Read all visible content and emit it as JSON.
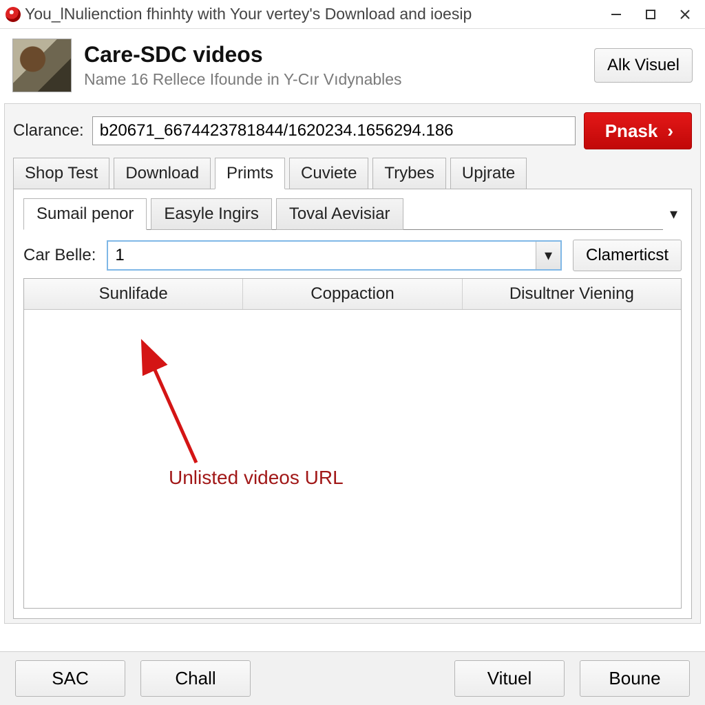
{
  "window": {
    "title": "You_lNulienction fhinhty with Your vertey's Download and ioesip"
  },
  "header": {
    "title": "Care-SDC videos",
    "subtitle": "Name 16 Rellece Ifounde in Y-Cır Vıdynables",
    "alk_label": "Alk Visuel"
  },
  "clarance": {
    "label": "Clarance:",
    "value": "b20671_6674423781844/1620234.1656294.186",
    "pnask_label": "Pnask"
  },
  "tabs": {
    "items": [
      {
        "label": "Shop Test"
      },
      {
        "label": "Download"
      },
      {
        "label": "Primts"
      },
      {
        "label": "Cuviete"
      },
      {
        "label": "Trybes"
      },
      {
        "label": "Upjrate"
      }
    ],
    "active_index": 2
  },
  "subtabs": {
    "items": [
      {
        "label": "Sumail penor"
      },
      {
        "label": "Easyle Ingirs"
      },
      {
        "label": "Toval Aevisiar"
      }
    ],
    "active_index": 0
  },
  "carbelle": {
    "label": "Car Belle:",
    "value": "1",
    "button_label": "Clamerticst"
  },
  "table": {
    "columns": [
      "Sunlifade",
      "Coppaction",
      "Disultner Viening"
    ],
    "rows": []
  },
  "annotation": {
    "text": "Unlisted videos URL"
  },
  "footer": {
    "sac": "SAC",
    "chall": "Chall",
    "vituel": "Vituel",
    "boune": "Boune"
  },
  "colors": {
    "primary_red": "#d41515",
    "annotation_red": "#a11818"
  }
}
